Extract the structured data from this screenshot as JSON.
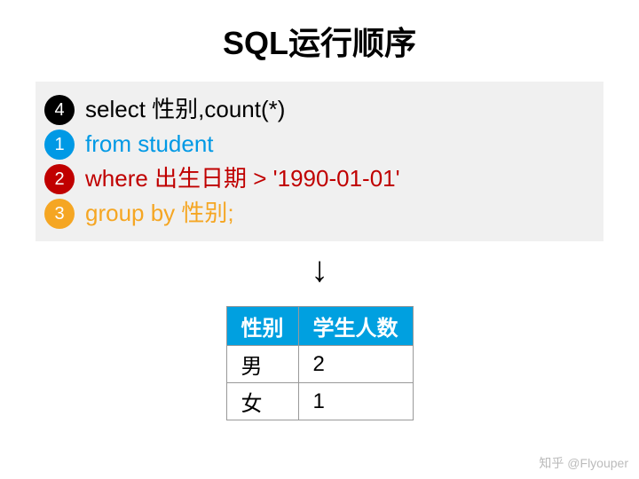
{
  "title": "SQL运行顺序",
  "sql": {
    "lines": [
      {
        "num": "4",
        "circleClass": "c-black",
        "textClass": "txt-black",
        "code": "select 性别,count(*)"
      },
      {
        "num": "1",
        "circleClass": "c-blue",
        "textClass": "txt-blue",
        "code": "from student"
      },
      {
        "num": "2",
        "circleClass": "c-red",
        "textClass": "txt-red",
        "code": "where 出生日期 > '1990-01-01'"
      },
      {
        "num": "3",
        "circleClass": "c-orange",
        "textClass": "txt-orange",
        "code": "group by 性别;"
      }
    ]
  },
  "arrow": "↓",
  "chart_data": {
    "type": "table",
    "headers": [
      "性别",
      "学生人数"
    ],
    "rows": [
      [
        "男",
        "2"
      ],
      [
        "女",
        "1"
      ]
    ]
  },
  "watermark": "知乎 @Flyouper"
}
